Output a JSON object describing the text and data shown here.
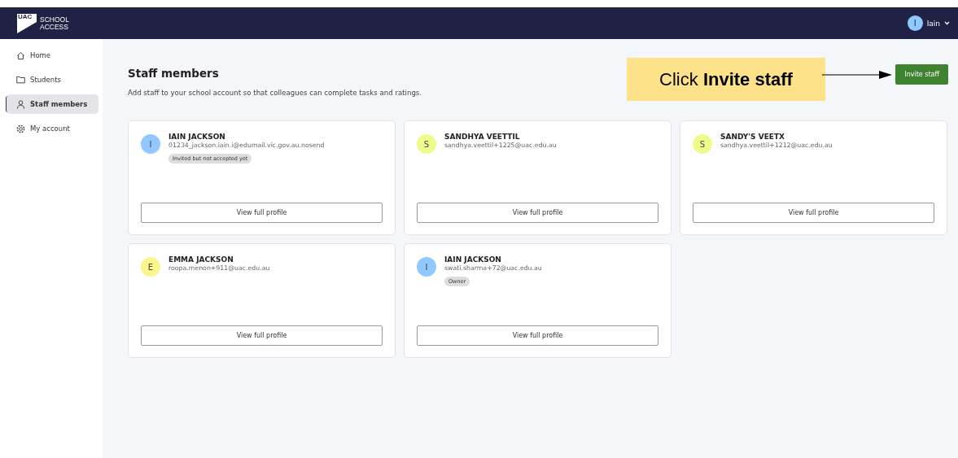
{
  "header": {
    "logo_mark": "UAC",
    "logo_text": "SCHOOL\nACCESS",
    "user": {
      "initial": "I",
      "name": "Iain"
    }
  },
  "sidebar": {
    "items": [
      {
        "label": "Home",
        "selected": false
      },
      {
        "label": "Students",
        "selected": false
      },
      {
        "label": "Staff members",
        "selected": true
      },
      {
        "label": "My account",
        "selected": false
      }
    ]
  },
  "page": {
    "title": "Staff members",
    "subtitle": "Add staff to your school account so that colleagues can complete tasks and ratings.",
    "invite_button": "Invite staff"
  },
  "callout": {
    "text": "Click **Invite staff**"
  },
  "staff": [
    {
      "initial": "I",
      "color": "#90c8ff",
      "name": "IAIN JACKSON",
      "email": "01234_jackson.iain.i@edumail.vic.gov.au.nosend",
      "badge": "Invited but not accepted yet",
      "button": "View full profile"
    },
    {
      "initial": "S",
      "color": "#eefc8c",
      "name": "SANDHYA VEETTIL",
      "email": "sandhya.veettil+1225@uac.edu.au",
      "button": "View full profile"
    },
    {
      "initial": "S",
      "color": "#eefc8c",
      "name": "SANDY'S VEETX",
      "email": "sandhya.veettil+1212@uac.edu.au",
      "button": "View full profile"
    },
    {
      "initial": "E",
      "color": "#fdf68c",
      "name": "EMMA JACKSON",
      "email": "roopa.menon+911@uac.edu.au",
      "button": "View full profile"
    },
    {
      "initial": "I",
      "color": "#90c8ff",
      "name": "IAIN JACKSON",
      "email": "swati.sharma+72@uac.edu.au",
      "badge": "Owner",
      "button": "View full profile"
    }
  ]
}
